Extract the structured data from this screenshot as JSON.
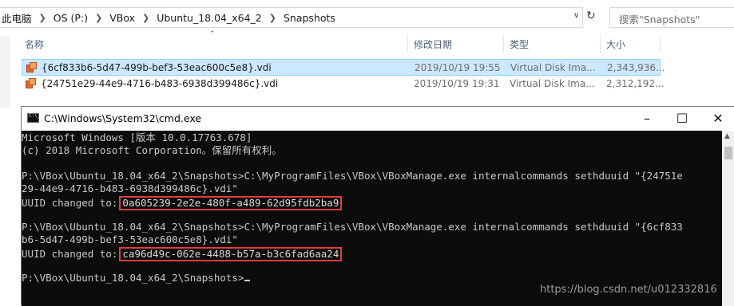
{
  "explorer": {
    "breadcrumb": [
      "此电脑",
      "OS (P:)",
      "VBox",
      "Ubuntu_18.04_x64_2",
      "Snapshots"
    ],
    "search_placeholder": "搜索\"Snapshots\"",
    "columns": {
      "name": "名称",
      "modified": "修改日期",
      "type": "类型",
      "size": "大小"
    },
    "files": [
      {
        "name": "{6cf833b6-5d47-499b-bef3-53eac600c5e8}.vdi",
        "modified": "2019/10/19 19:55",
        "type": "Virtual Disk Ima...",
        "size": "2,343,936..."
      },
      {
        "name": "{24751e29-44e9-4716-b483-6938d399486c}.vdi",
        "modified": "2019/10/19 19:31",
        "type": "Virtual Disk Ima...",
        "size": "2,312,192..."
      }
    ]
  },
  "cmd": {
    "title": "C:\\Windows\\System32\\cmd.exe",
    "lines": {
      "l1": "Microsoft Windows [版本 10.0.17763.678]",
      "l2": "(c) 2018 Microsoft Corporation。保留所有权利。",
      "cmd1a": "P:\\VBox\\Ubuntu_18.04_x64_2\\Snapshots>C:\\MyProgramFiles\\VBox\\VBoxManage.exe internalcommands sethduuid \"{24751e",
      "cmd1b": "29-44e9-4716-b483-6938d399486c}.vdi\"",
      "uuid_prefix": "UUID changed to:",
      "uuid1": "0a605239-2e2e-480f-a489-62d95fdb2ba9",
      "cmd2a": "P:\\VBox\\Ubuntu_18.04_x64_2\\Snapshots>C:\\MyProgramFiles\\VBox\\VBoxManage.exe internalcommands sethduuid \"{6cf833",
      "cmd2b": "b6-5d47-499b-bef3-53eac600c5e8}.vdi\"",
      "uuid2": "ca96d49c-062e-4488-b57a-b3c6fad6aa24",
      "prompt": "P:\\VBox\\Ubuntu_18.04_x64_2\\Snapshots>"
    }
  },
  "watermark": "https://blog.csdn.net/u012332816"
}
